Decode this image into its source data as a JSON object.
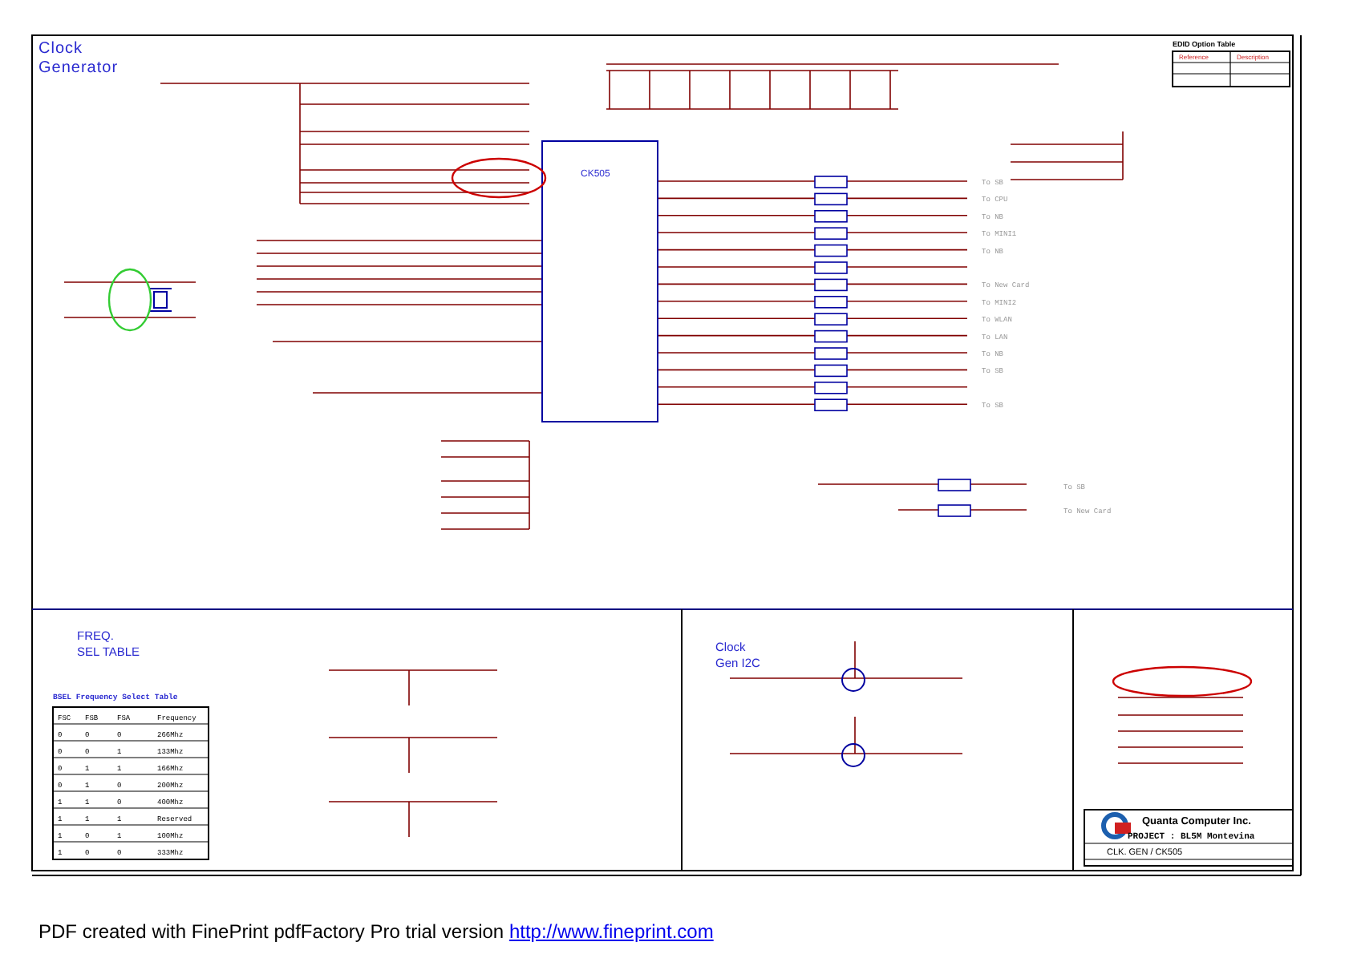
{
  "sheet": {
    "title": "Clock Generator",
    "chip_label": "CK505",
    "freq_title": "FREQ. SEL TABLE",
    "i2c_title": "Clock Gen I2C"
  },
  "route_labels": [
    "To SB",
    "To CPU",
    "To NB",
    "To MINI1",
    "To NB",
    "To New Card",
    "To MINI2",
    "To WLAN",
    "To LAN",
    "To NB",
    "To SB",
    "To SB"
  ],
  "lower_labels": [
    "To SB",
    "To New Card"
  ],
  "freq_table": {
    "title": "BSEL Frequency Select Table",
    "columns": [
      "FSC",
      "FSB",
      "FSA",
      "Frequency"
    ],
    "rows": [
      [
        "0",
        "0",
        "0",
        "266Mhz"
      ],
      [
        "0",
        "0",
        "1",
        "133Mhz"
      ],
      [
        "0",
        "1",
        "1",
        "166Mhz"
      ],
      [
        "0",
        "1",
        "0",
        "200Mhz"
      ],
      [
        "1",
        "1",
        "0",
        "400Mhz"
      ],
      [
        "1",
        "1",
        "1",
        "Reserved"
      ],
      [
        "1",
        "0",
        "1",
        "100Mhz"
      ],
      [
        "1",
        "0",
        "0",
        "333Mhz"
      ]
    ]
  },
  "edid_table": {
    "title": "EDID Option Table",
    "columns": [
      "Reference",
      "Description"
    ]
  },
  "title_block": {
    "company": "Quanta Computer Inc.",
    "project": "PROJECT : BL5M Montevina",
    "drawing_title": "CLK. GEN / CK505"
  },
  "footer": {
    "text": "PDF created with FinePrint pdfFactory Pro trial version ",
    "link": "http://www.fineprint.com"
  }
}
